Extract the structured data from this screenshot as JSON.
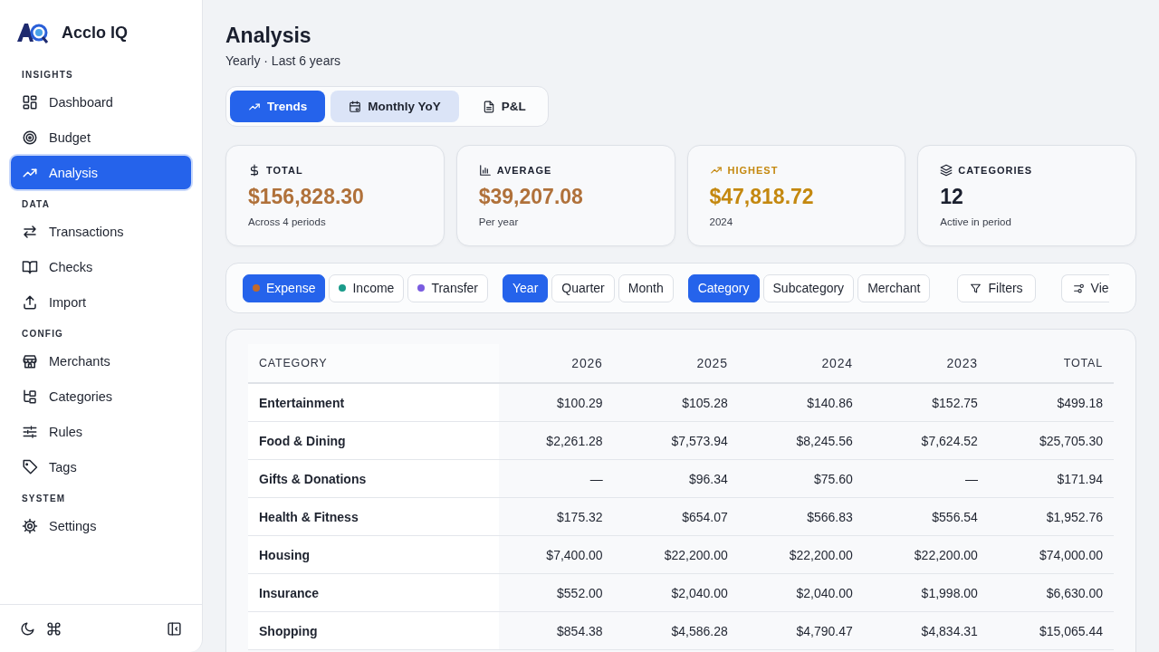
{
  "app": {
    "name": "Acclo IQ"
  },
  "sidebar": {
    "sections": [
      {
        "label": "INSIGHTS",
        "items": [
          {
            "label": "Dashboard",
            "selected": false
          },
          {
            "label": "Budget",
            "selected": false
          },
          {
            "label": "Analysis",
            "selected": true
          }
        ]
      },
      {
        "label": "DATA",
        "items": [
          {
            "label": "Transactions",
            "selected": false
          },
          {
            "label": "Checks",
            "selected": false
          },
          {
            "label": "Import",
            "selected": false
          }
        ]
      },
      {
        "label": "CONFIG",
        "items": [
          {
            "label": "Merchants",
            "selected": false
          },
          {
            "label": "Categories",
            "selected": false
          },
          {
            "label": "Rules",
            "selected": false
          },
          {
            "label": "Tags",
            "selected": false
          }
        ]
      },
      {
        "label": "SYSTEM",
        "items": [
          {
            "label": "Settings",
            "selected": false
          }
        ]
      }
    ]
  },
  "page": {
    "title": "Analysis",
    "subtitle": "Yearly · Last 6 years"
  },
  "tabs": [
    {
      "label": "Trends",
      "selected": true
    },
    {
      "label": "Monthly YoY",
      "selected": false,
      "hover": true
    },
    {
      "label": "P&L",
      "selected": false,
      "hover": false
    }
  ],
  "stats": [
    {
      "label": "TOTAL",
      "value": "$156,828.30",
      "note": "Across 4 periods",
      "color": "#b0713a"
    },
    {
      "label": "AVERAGE",
      "value": "$39,207.08",
      "note": "Per year",
      "color": "#b0713a"
    },
    {
      "label": "HIGHEST",
      "value": "$47,818.72",
      "note": "2024",
      "color": "#c4880f"
    },
    {
      "label": "CATEGORIES",
      "value": "12",
      "note": "Active in period",
      "color": "#1a1f2e"
    }
  ],
  "toolbar": {
    "types": [
      {
        "label": "Expense",
        "selected": true,
        "color": "#c2692a"
      },
      {
        "label": "Income",
        "selected": false,
        "color": "#1a9b8a"
      },
      {
        "label": "Transfer",
        "selected": false,
        "color": "#7a5ce0"
      }
    ],
    "periods": [
      {
        "label": "Year",
        "selected": true
      },
      {
        "label": "Quarter",
        "selected": false
      },
      {
        "label": "Month",
        "selected": false
      }
    ],
    "groupings": [
      {
        "label": "Category",
        "selected": true
      },
      {
        "label": "Subcategory",
        "selected": false
      },
      {
        "label": "Merchant",
        "selected": false
      }
    ],
    "filters": "Filters",
    "view": "Vie"
  },
  "table": {
    "columns": [
      "CATEGORY",
      "2026",
      "2025",
      "2024",
      "2023",
      "TOTAL"
    ],
    "rows": [
      [
        "Entertainment",
        "$100.29",
        "$105.28",
        "$140.86",
        "$152.75",
        "$499.18"
      ],
      [
        "Food & Dining",
        "$2,261.28",
        "$7,573.94",
        "$8,245.56",
        "$7,624.52",
        "$25,705.30"
      ],
      [
        "Gifts & Donations",
        "—",
        "$96.34",
        "$75.60",
        "—",
        "$171.94"
      ],
      [
        "Health & Fitness",
        "$175.32",
        "$654.07",
        "$566.83",
        "$556.54",
        "$1,952.76"
      ],
      [
        "Housing",
        "$7,400.00",
        "$22,200.00",
        "$22,200.00",
        "$22,200.00",
        "$74,000.00"
      ],
      [
        "Insurance",
        "$552.00",
        "$2,040.00",
        "$2,040.00",
        "$1,998.00",
        "$6,630.00"
      ],
      [
        "Shopping",
        "$854.38",
        "$4,586.28",
        "$4,790.47",
        "$4,834.31",
        "$15,065.44"
      ]
    ]
  }
}
